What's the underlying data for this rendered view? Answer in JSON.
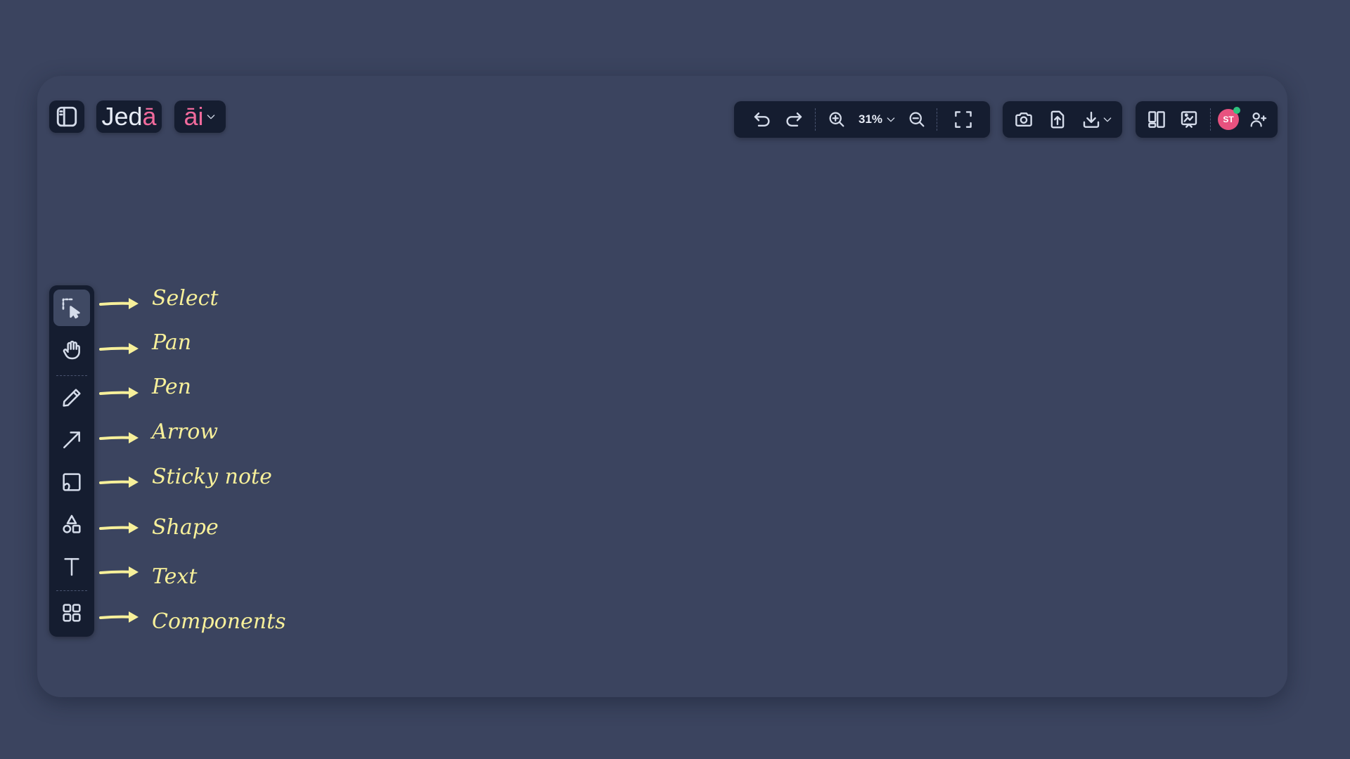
{
  "app": {
    "logo_text": "Jed",
    "logo_accent": "ā",
    "ai_text": "āi",
    "accent_color": "#f06a9c"
  },
  "topbar": {
    "zoom_level": "31%",
    "avatar_initials": "ST",
    "avatar_color": "#e8527f",
    "presence_color": "#2ec27e"
  },
  "tools": [
    {
      "label": "Select",
      "icon": "select-icon"
    },
    {
      "label": "Pan",
      "icon": "hand-icon"
    },
    {
      "label": "Pen",
      "icon": "pen-icon"
    },
    {
      "label": "Arrow",
      "icon": "arrow-icon"
    },
    {
      "label": "Sticky note",
      "icon": "sticky-note-icon"
    },
    {
      "label": "Shape",
      "icon": "shapes-icon"
    },
    {
      "label": "Text",
      "icon": "text-icon"
    },
    {
      "label": "Components",
      "icon": "components-icon"
    }
  ],
  "annotation_color": "#f7f09a"
}
